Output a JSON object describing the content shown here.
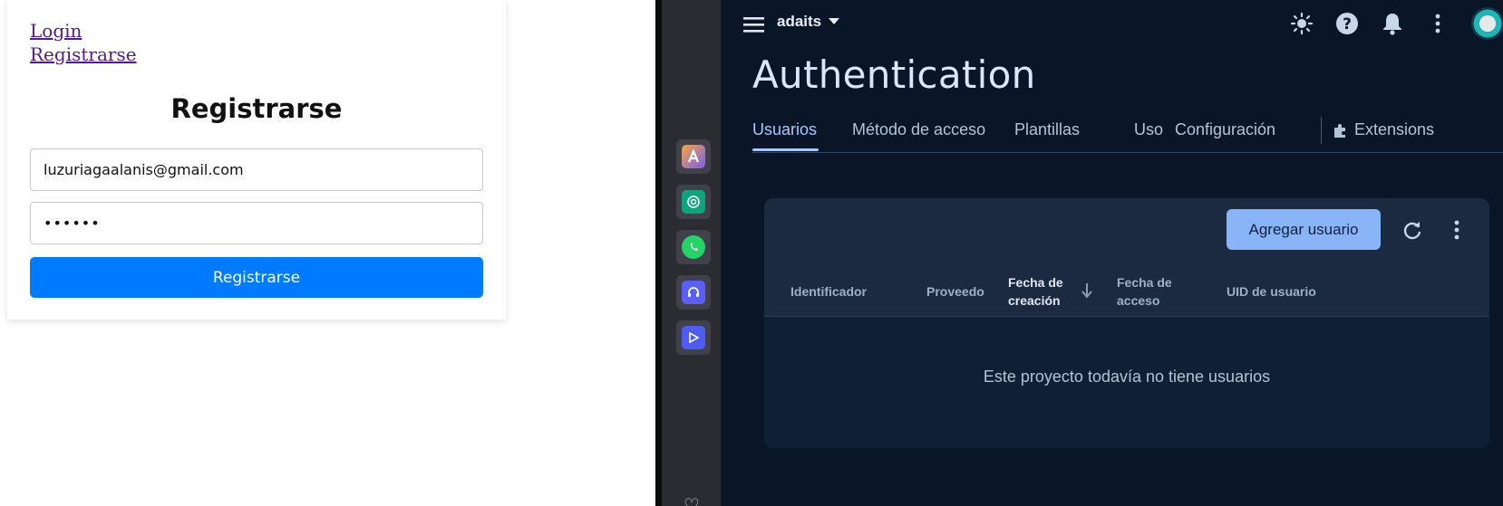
{
  "left_page": {
    "links": {
      "login": "Login",
      "register": "Registrarse"
    },
    "form": {
      "title": "Registrarse",
      "email_value": "luzuriagaalanis@gmail.com",
      "password_value": "••••••",
      "submit_label": "Registrarse"
    }
  },
  "rail": {
    "items": [
      {
        "icon": "arc-app-icon",
        "color": "#f6a742"
      },
      {
        "icon": "chatgpt-icon",
        "color": "#10a37f"
      },
      {
        "icon": "whatsapp-icon",
        "color": "#25d366"
      },
      {
        "icon": "headset-icon",
        "color": "#5b5ef7"
      },
      {
        "icon": "play-arrow-icon",
        "color": "#4e5cf0"
      }
    ]
  },
  "console": {
    "project_name": "adaits",
    "page_title": "Authentication",
    "tabs": [
      {
        "label": "Usuarios",
        "active": true
      },
      {
        "label": "Método de acceso"
      },
      {
        "label": "Plantillas"
      },
      {
        "label": "Uso"
      },
      {
        "label": "Configuración"
      },
      {
        "label": "Extensions",
        "icon": "extension-icon"
      }
    ],
    "panel": {
      "add_user_label": "Agregar usuario",
      "columns": {
        "identifier": "Identificador",
        "provider": "Proveedo",
        "created_line1": "Fecha de",
        "created_line2": "creación",
        "access_line1": "Fecha de",
        "access_line2": "acceso",
        "uid": "UID de usuario"
      },
      "sorted_column": "created",
      "empty_message": "Este proyecto todavía no tiene usuarios"
    },
    "colors": {
      "background": "#0a1628",
      "panel": "#1b2a41",
      "accent": "#8ab4f8"
    }
  }
}
